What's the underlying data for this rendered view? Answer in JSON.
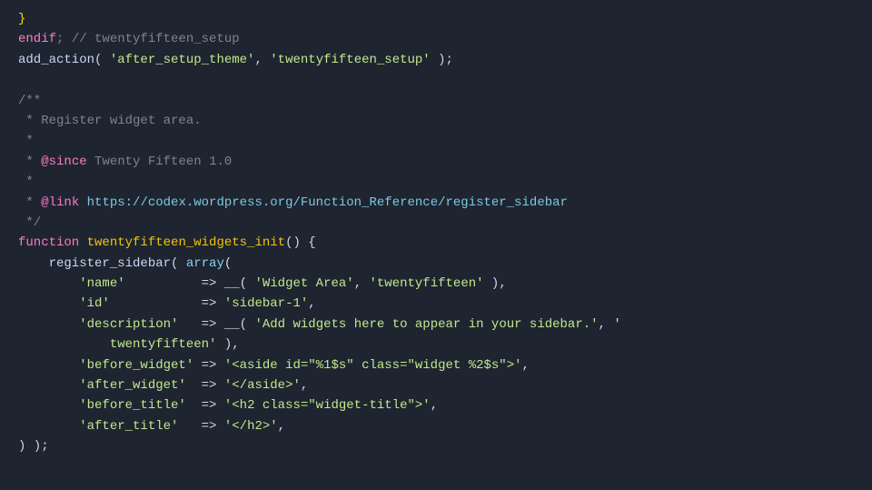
{
  "code": {
    "lines": [
      {
        "id": 1,
        "tokens": [
          {
            "text": "}",
            "color": "brace"
          }
        ]
      },
      {
        "id": 2,
        "tokens": [
          {
            "text": "endif",
            "color": "keyword-pink"
          },
          {
            "text": "; // twentyfifteen_setup",
            "color": "comment-gray"
          }
        ]
      },
      {
        "id": 3,
        "tokens": [
          {
            "text": "add_action",
            "color": "white"
          },
          {
            "text": "( ",
            "color": "white"
          },
          {
            "text": "'after_setup_theme'",
            "color": "string-green"
          },
          {
            "text": ", ",
            "color": "white"
          },
          {
            "text": "'twentyfifteen_setup'",
            "color": "string-green"
          },
          {
            "text": " );",
            "color": "white"
          }
        ]
      },
      {
        "id": 4,
        "tokens": []
      },
      {
        "id": 5,
        "tokens": [
          {
            "text": "/**",
            "color": "comment-gray"
          }
        ]
      },
      {
        "id": 6,
        "tokens": [
          {
            "text": " * Register widget area.",
            "color": "comment-gray"
          }
        ]
      },
      {
        "id": 7,
        "tokens": [
          {
            "text": " *",
            "color": "comment-gray"
          }
        ]
      },
      {
        "id": 8,
        "tokens": [
          {
            "text": " * ",
            "color": "comment-gray"
          },
          {
            "text": "@since",
            "color": "at-since"
          },
          {
            "text": " Twenty Fifteen 1.0",
            "color": "comment-gray"
          }
        ]
      },
      {
        "id": 9,
        "tokens": [
          {
            "text": " *",
            "color": "comment-gray"
          }
        ]
      },
      {
        "id": 10,
        "tokens": [
          {
            "text": " * ",
            "color": "comment-gray"
          },
          {
            "text": "@link",
            "color": "at-since"
          },
          {
            "text": " https://codex.wordpress.org/Function_Reference/register_sidebar",
            "color": "comment-link"
          }
        ]
      },
      {
        "id": 11,
        "tokens": [
          {
            "text": " */",
            "color": "comment-gray"
          }
        ]
      },
      {
        "id": 12,
        "tokens": [
          {
            "text": "function",
            "color": "keyword-pink"
          },
          {
            "text": " ",
            "color": "white"
          },
          {
            "text": "twentyfifteen_widgets_init",
            "color": "func-yellow"
          },
          {
            "text": "() {",
            "color": "white"
          }
        ]
      },
      {
        "id": 13,
        "tokens": [
          {
            "text": "    register_sidebar",
            "color": "white"
          },
          {
            "text": "( ",
            "color": "white"
          },
          {
            "text": "array",
            "color": "light-blue"
          },
          {
            "text": "(",
            "color": "white"
          }
        ]
      },
      {
        "id": 14,
        "tokens": [
          {
            "text": "        'name'",
            "color": "string-green"
          },
          {
            "text": "          => ",
            "color": "white"
          },
          {
            "text": "__(",
            "color": "white"
          },
          {
            "text": " 'Widget Area'",
            "color": "string-green"
          },
          {
            "text": ", ",
            "color": "white"
          },
          {
            "text": "'twentyfifteen'",
            "color": "string-green"
          },
          {
            "text": " ),",
            "color": "white"
          }
        ]
      },
      {
        "id": 15,
        "tokens": [
          {
            "text": "        'id'",
            "color": "string-green"
          },
          {
            "text": "            => ",
            "color": "white"
          },
          {
            "text": "'sidebar-1'",
            "color": "string-green"
          },
          {
            "text": ",",
            "color": "white"
          }
        ]
      },
      {
        "id": 16,
        "tokens": [
          {
            "text": "        'description'",
            "color": "string-green"
          },
          {
            "text": "   => ",
            "color": "white"
          },
          {
            "text": "__(",
            "color": "white"
          },
          {
            "text": " 'Add widgets here to appear in your sidebar.'",
            "color": "string-green"
          },
          {
            "text": ", '",
            "color": "white"
          }
        ]
      },
      {
        "id": 17,
        "tokens": [
          {
            "text": "            twentyfifteen'",
            "color": "string-green"
          },
          {
            "text": " ),",
            "color": "white"
          }
        ]
      },
      {
        "id": 18,
        "tokens": [
          {
            "text": "        'before_widget'",
            "color": "string-green"
          },
          {
            "text": " => ",
            "color": "white"
          },
          {
            "text": "'<aside id=\"%1$s\" class=\"widget %2$s\">'",
            "color": "string-green"
          },
          {
            "text": ",",
            "color": "white"
          }
        ]
      },
      {
        "id": 19,
        "tokens": [
          {
            "text": "        'after_widget'",
            "color": "string-green"
          },
          {
            "text": "  => ",
            "color": "white"
          },
          {
            "text": "'</aside>'",
            "color": "string-green"
          },
          {
            "text": ",",
            "color": "white"
          }
        ]
      },
      {
        "id": 20,
        "tokens": [
          {
            "text": "        'before_title'",
            "color": "string-green"
          },
          {
            "text": "  => ",
            "color": "white"
          },
          {
            "text": "'<h2 class=\"widget-title\">'",
            "color": "string-green"
          },
          {
            "text": ",",
            "color": "white"
          }
        ]
      },
      {
        "id": 21,
        "tokens": [
          {
            "text": "        'after_title'",
            "color": "string-green"
          },
          {
            "text": "   => ",
            "color": "white"
          },
          {
            "text": "'</h2>'",
            "color": "string-green"
          },
          {
            "text": ",",
            "color": "white"
          }
        ]
      },
      {
        "id": 22,
        "tokens": [
          {
            "text": ") );",
            "color": "white"
          }
        ]
      }
    ]
  }
}
